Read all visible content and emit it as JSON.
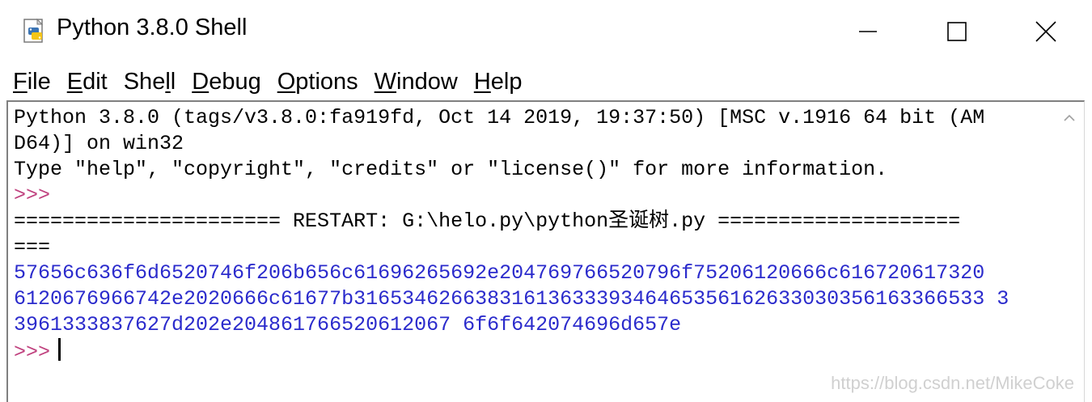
{
  "window": {
    "title": "Python 3.8.0 Shell",
    "icon": "python-file-icon"
  },
  "titlebar_buttons": {
    "minimize_icon": "minimize-icon",
    "maximize_icon": "maximize-icon",
    "close_icon": "close-icon"
  },
  "menu": {
    "items": [
      {
        "underline": "F",
        "rest": "ile",
        "label": "File"
      },
      {
        "underline": "E",
        "rest": "dit",
        "label": "Edit"
      },
      {
        "pre": "She",
        "underline": "l",
        "rest": "l",
        "label": "Shell"
      },
      {
        "underline": "D",
        "rest": "ebug",
        "label": "Debug"
      },
      {
        "underline": "O",
        "rest": "ptions",
        "label": "Options"
      },
      {
        "underline": "W",
        "rest": "indow",
        "label": "Window"
      },
      {
        "underline": "H",
        "rest": "elp",
        "label": "Help"
      }
    ]
  },
  "shell": {
    "lines": [
      "Python 3.8.0 (tags/v3.8.0:fa919fd, Oct 14 2019, 19:37:50) [MSC v.1916 64 bit (AM",
      "D64)] on win32",
      "Type \"help\", \"copyright\", \"credits\" or \"license()\" for more information.",
      ">>>",
      "====================== RESTART: G:\\helo.py\\python圣诞树.py ====================",
      "===",
      "57656c636f6d6520746f206b656c61696265692e204769766520796f75206120666c616720617320",
      "6120676966742e2020666c61677b31653462663831613633393464653561626330303561633665333",
      "3961333837627d202e204861766520612067 6f6f642074696d657e",
      ">>> "
    ],
    "restart_line": "====================== RESTART: G:\\helo.py\\python圣诞树.py ====================",
    "restart_cont": "===",
    "prompt": ">>>",
    "output_lines": [
      "57656c636f6d6520746f206b656c61696265692e204769766520796f75206120666c616720617320",
      "6120676966742e2020666c61677b3165346266383161363339346465356162633030356163366533 3",
      "3961333837627d202e204861766520612067 6f6f642074696d657e"
    ]
  },
  "colors": {
    "prompt": "#c0427f",
    "output": "#2b2bcc",
    "text": "#000000"
  },
  "watermark": "https://blog.csdn.net/MikeCoke"
}
